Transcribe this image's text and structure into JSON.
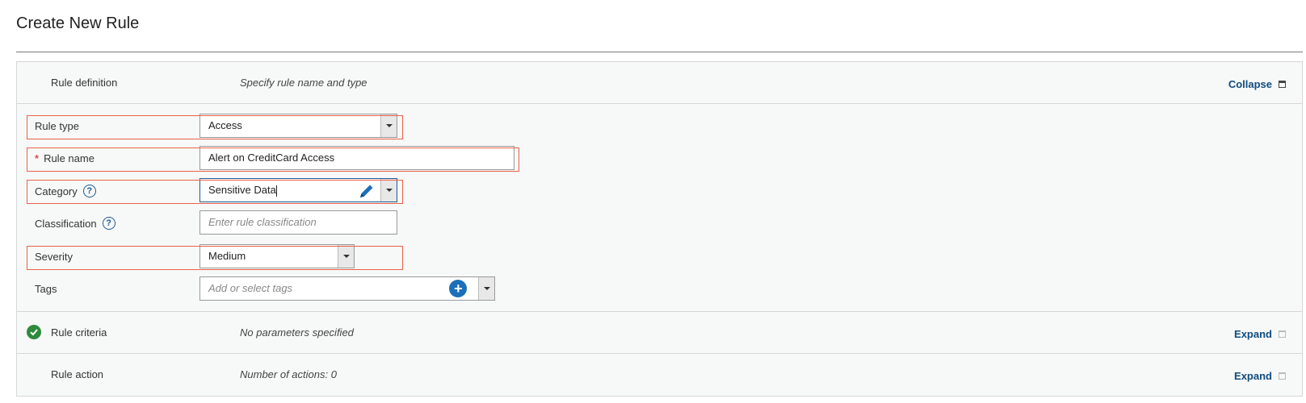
{
  "page": {
    "title": "Create New Rule"
  },
  "sections": {
    "definition": {
      "name": "Rule definition",
      "description": "Specify rule name and type",
      "toggle_label": "Collapse"
    },
    "criteria": {
      "name": "Rule criteria",
      "description": "No parameters specified",
      "toggle_label": "Expand"
    },
    "action": {
      "name": "Rule action",
      "description": "Number of actions: 0",
      "toggle_label": "Expand"
    }
  },
  "form": {
    "rule_type": {
      "label": "Rule type",
      "value": "Access"
    },
    "rule_name": {
      "required_marker": "*",
      "label": "Rule name",
      "value": "Alert on CreditCard Access"
    },
    "category": {
      "label": "Category",
      "help": "?",
      "value": "Sensitive Data"
    },
    "classification": {
      "label": "Classification",
      "help": "?",
      "placeholder": "Enter rule classification"
    },
    "severity": {
      "label": "Severity",
      "value": "Medium"
    },
    "tags": {
      "label": "Tags",
      "placeholder": "Add or select tags",
      "add_symbol": "+"
    }
  },
  "colors": {
    "accent": "#0f4c81",
    "highlight": "#e8634a",
    "success": "#2e8b3d",
    "add_button": "#1d6fb8"
  }
}
